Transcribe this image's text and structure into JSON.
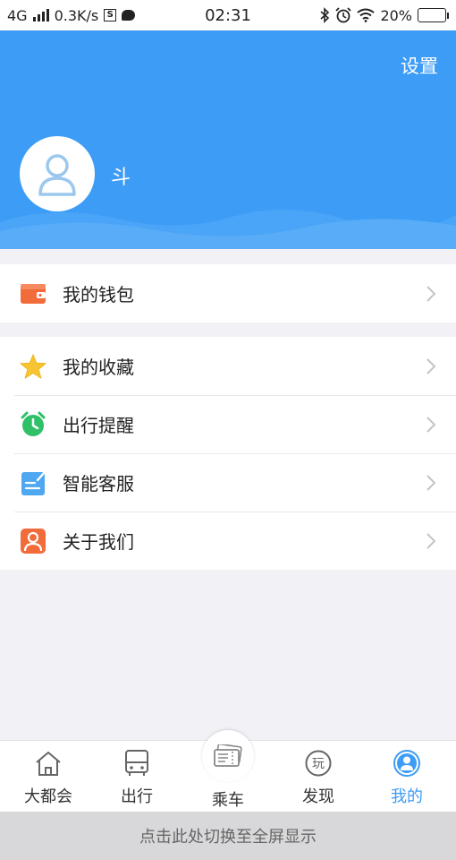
{
  "status_bar": {
    "network": "4G",
    "speed": "0.3K/s",
    "time": "02:31",
    "battery": "20%",
    "battery_level": 0.2
  },
  "header": {
    "settings_label": "设置",
    "username": "斗"
  },
  "menu": {
    "group1": [
      {
        "label": "我的钱包",
        "icon": "wallet-icon",
        "color": "#f26b3a"
      }
    ],
    "group2": [
      {
        "label": "我的收藏",
        "icon": "star-icon",
        "color": "#f7c531"
      },
      {
        "label": "出行提醒",
        "icon": "alarm-clock-icon",
        "color": "#2fc068"
      },
      {
        "label": "智能客服",
        "icon": "customer-service-note-icon",
        "color": "#4ea7f0"
      },
      {
        "label": "关于我们",
        "icon": "person-icon",
        "color": "#f26b3a"
      }
    ]
  },
  "tabs": [
    {
      "label": "大都会",
      "icon": "home-icon"
    },
    {
      "label": "出行",
      "icon": "bus-icon"
    },
    {
      "label": "乘车",
      "icon": "ticket-icon"
    },
    {
      "label": "发现",
      "icon": "discover-play-icon",
      "icon_text": "玩"
    },
    {
      "label": "我的",
      "icon": "profile-icon",
      "active": true
    }
  ],
  "fullscreen_hint": "点击此处切换至全屏显示",
  "colors": {
    "accent": "#3d9cf6",
    "background": "#f1f1f6"
  }
}
